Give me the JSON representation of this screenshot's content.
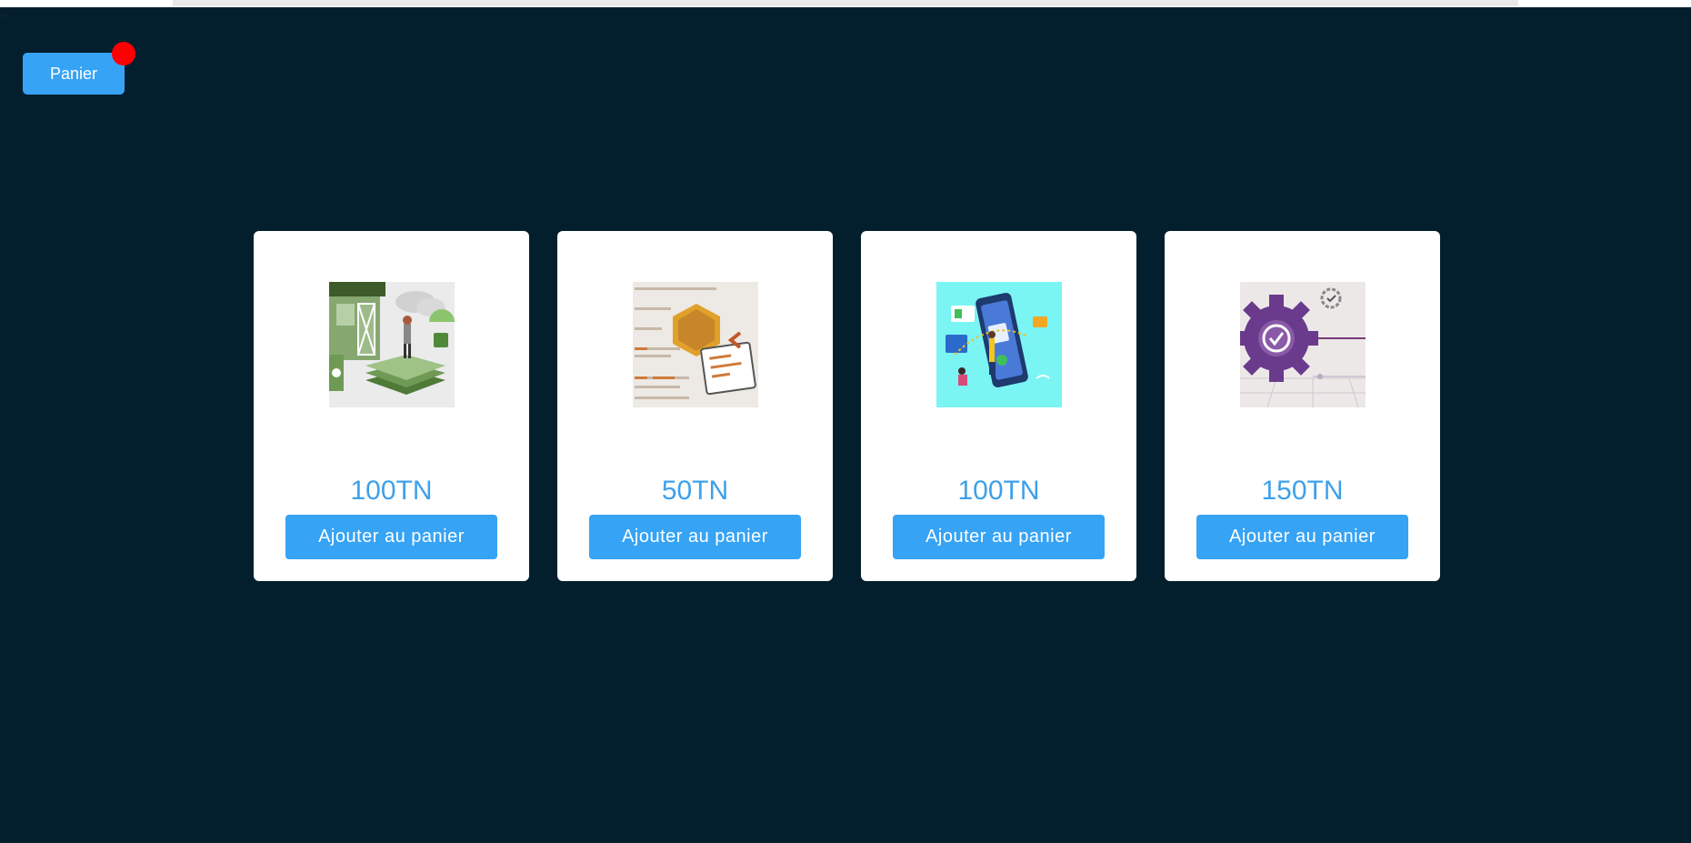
{
  "header": {
    "back_glyph": "<",
    "cart_label": "Panier",
    "cart_badge_color": "#ff0000"
  },
  "products": [
    {
      "price": "100TN",
      "add_label": "Ajouter au panier",
      "image": "cloud-deploy-illustration"
    },
    {
      "price": "50TN",
      "add_label": "Ajouter au panier",
      "image": "csharp-code-illustration"
    },
    {
      "price": "100TN",
      "add_label": "Ajouter au panier",
      "image": "mobile-app-illustration"
    },
    {
      "price": "150TN",
      "add_label": "Ajouter au panier",
      "image": "gear-check-illustration"
    }
  ],
  "colors": {
    "background": "#031f2e",
    "accent": "#36a3f4",
    "price": "#3ea0ea"
  }
}
